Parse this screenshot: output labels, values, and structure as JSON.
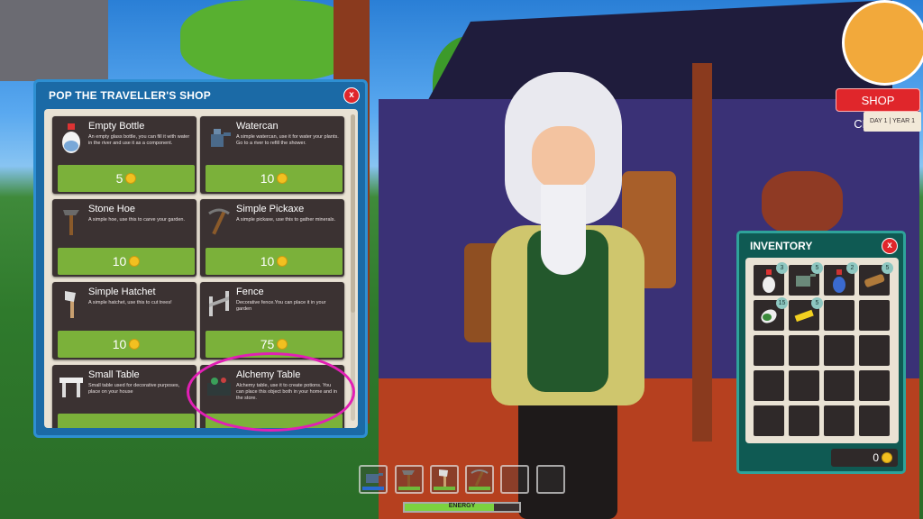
{
  "shop": {
    "title": "POP THE TRAVELLER'S SHOP",
    "close_label": "x",
    "items": [
      {
        "name": "Empty Bottle",
        "desc": "An empty glass bottle, you can fill it with water in the river and use it as a component.",
        "price": "5",
        "icon": "bottle-icon"
      },
      {
        "name": "Watercan",
        "desc": "A simple watercan, use it for water your plants. Go to a river to refill the shower.",
        "price": "10",
        "icon": "watercan-icon"
      },
      {
        "name": "Stone Hoe",
        "desc": "A simple hoe, use this to carve your garden.",
        "price": "10",
        "icon": "hoe-icon"
      },
      {
        "name": "Simple Pickaxe",
        "desc": "A simple pickaxe, use this to gather minerals.",
        "price": "10",
        "icon": "pickaxe-icon"
      },
      {
        "name": "Simple Hatchet",
        "desc": "A simple hatchet, use this to cut trees!",
        "price": "10",
        "icon": "hatchet-icon"
      },
      {
        "name": "Fence",
        "desc": "Decorative fence.You can place it in your garden",
        "price": "75",
        "icon": "fence-icon"
      },
      {
        "name": "Small Table",
        "desc": "Small table used for decorative purposes, place on your house",
        "price": "",
        "icon": "table-icon"
      },
      {
        "name": "Alchemy Table",
        "desc": "Alchemy table, use it to create potions. You can place this object both in your home and in the store.",
        "price": "",
        "icon": "alchemy-table-icon"
      }
    ]
  },
  "inventory": {
    "title": "INVENTORY",
    "close_label": "x",
    "slots": [
      {
        "icon": "bottle-icon",
        "qty": "3"
      },
      {
        "icon": "watercan-icon",
        "qty": "5"
      },
      {
        "icon": "potion-icon",
        "qty": "2"
      },
      {
        "icon": "wood-log-icon",
        "qty": "5"
      },
      {
        "icon": "leaf-icon",
        "qty": "15"
      },
      {
        "icon": "gold-bar-icon",
        "qty": "5"
      }
    ],
    "money": "0"
  },
  "status": {
    "shop_state": "SHOP CLOSED",
    "date": "DAY 1 | YEAR 1"
  },
  "hotbar": {
    "slots": [
      "watercan-icon",
      "hoe-icon",
      "hatchet-icon",
      "pickaxe-icon",
      "",
      ""
    ]
  },
  "energy": {
    "label": "ENERGY",
    "level": 0.78
  },
  "colors": {
    "shop_panel": "#1b6aa6",
    "inventory_panel": "#0f5a53",
    "price_bar": "#7bb13a",
    "close_button": "#e0262b",
    "highlight": "#e21fb5"
  }
}
